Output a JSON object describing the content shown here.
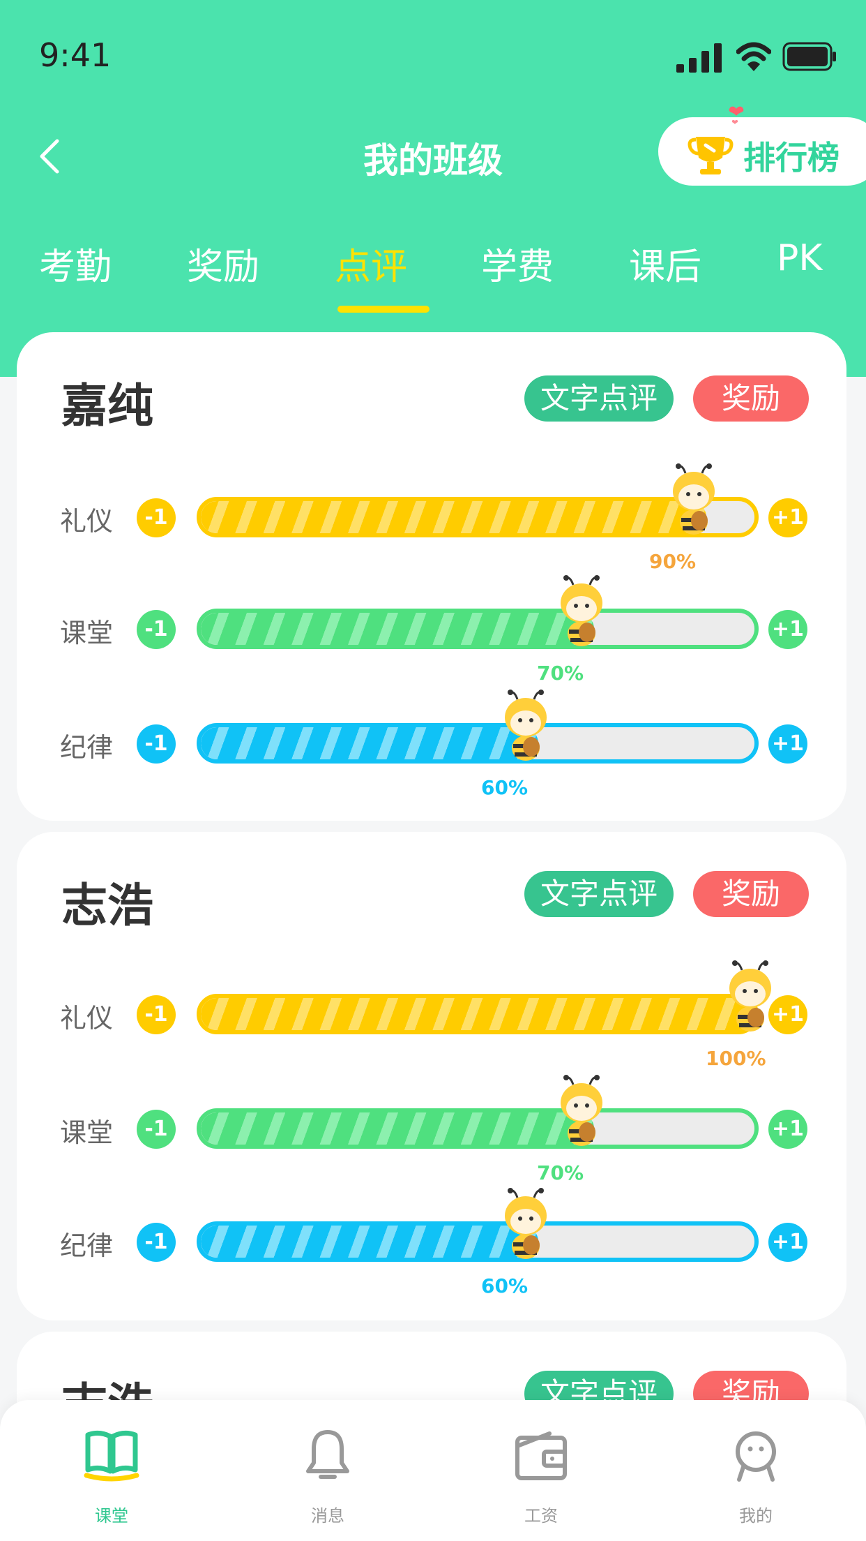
{
  "status_bar": {
    "time": "9:41"
  },
  "header": {
    "title": "我的班级",
    "ranking_label": "排行榜"
  },
  "tabs": [
    {
      "label": "考勤"
    },
    {
      "label": "奖励"
    },
    {
      "label": "点评",
      "active": true
    },
    {
      "label": "学费"
    },
    {
      "label": "课后"
    },
    {
      "label": "PK"
    }
  ],
  "students": [
    {
      "name": "嘉纯",
      "comment_label": "文字点评",
      "reward_label": "奖励",
      "metrics": [
        {
          "label": "礼仪",
          "minus": "-1",
          "plus": "+1",
          "percent_text": "90%",
          "value": 0.9
        },
        {
          "label": "课堂",
          "minus": "-1",
          "plus": "+1",
          "percent_text": "70%",
          "value": 0.7
        },
        {
          "label": "纪律",
          "minus": "-1",
          "plus": "+1",
          "percent_text": "60%",
          "value": 0.6
        }
      ]
    },
    {
      "name": "志浩",
      "comment_label": "文字点评",
      "reward_label": "奖励",
      "metrics": [
        {
          "label": "礼仪",
          "minus": "-1",
          "plus": "+1",
          "percent_text": "100%",
          "value": 1.0
        },
        {
          "label": "课堂",
          "minus": "-1",
          "plus": "+1",
          "percent_text": "70%",
          "value": 0.7
        },
        {
          "label": "纪律",
          "minus": "-1",
          "plus": "+1",
          "percent_text": "60%",
          "value": 0.6
        }
      ]
    },
    {
      "name": "志浩",
      "comment_label": "文字点评",
      "reward_label": "奖励"
    }
  ],
  "tab_bar": [
    {
      "label": "课堂",
      "icon": "book-icon",
      "active": true
    },
    {
      "label": "消息",
      "icon": "bell-icon"
    },
    {
      "label": "工资",
      "icon": "wallet-icon"
    },
    {
      "label": "我的",
      "icon": "profile-icon"
    }
  ],
  "colors": {
    "brand": "#4be3ad",
    "etiquette": "#ffcc00",
    "classroom": "#4fe07f",
    "discipline": "#10c2f6",
    "reward": "#fa6868",
    "comment": "#37c48f"
  }
}
